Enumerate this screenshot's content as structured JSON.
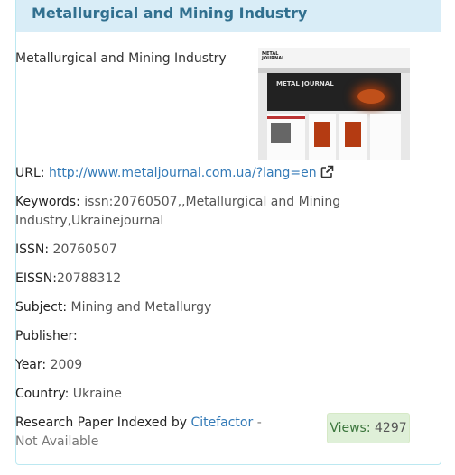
{
  "journal": {
    "title": "Metallurgical and Mining Industry",
    "description": "Metallurgical and Mining Industry",
    "thumbnail": {
      "logo_line1": "METAL",
      "logo_line2": "JOURNAL",
      "banner_text": "METAL JOURNAL"
    },
    "url_label": "URL:",
    "url": "http://www.metaljournal.com.ua/?lang=en",
    "keywords_label": "Keywords:",
    "keywords_line1": "issn:20760507,,Metallurgical and Mining",
    "keywords_line2": "Industry,Ukrainejournal",
    "issn_label": "ISSN:",
    "issn": "20760507",
    "eissn_label": "EISSN:",
    "eissn": "20788312",
    "subject_label": "Subject:",
    "subject": "Mining and Metallurgy",
    "publisher_label": "Publisher:",
    "publisher": "",
    "year_label": "Year:",
    "year": "2009",
    "country_label": "Country:",
    "country": "Ukraine",
    "indexed_prefix": "Research Paper Indexed by",
    "indexed_by": "Citefactor",
    "indexed_suffix": "- Not Available",
    "views_label": "Views:",
    "views": "4297"
  },
  "colors": {
    "header_bg": "#d9edf7",
    "title": "#31708f",
    "link": "#337ab7",
    "views_bg": "#dff0d8"
  },
  "icons": {
    "external_link": "external-link-icon"
  }
}
